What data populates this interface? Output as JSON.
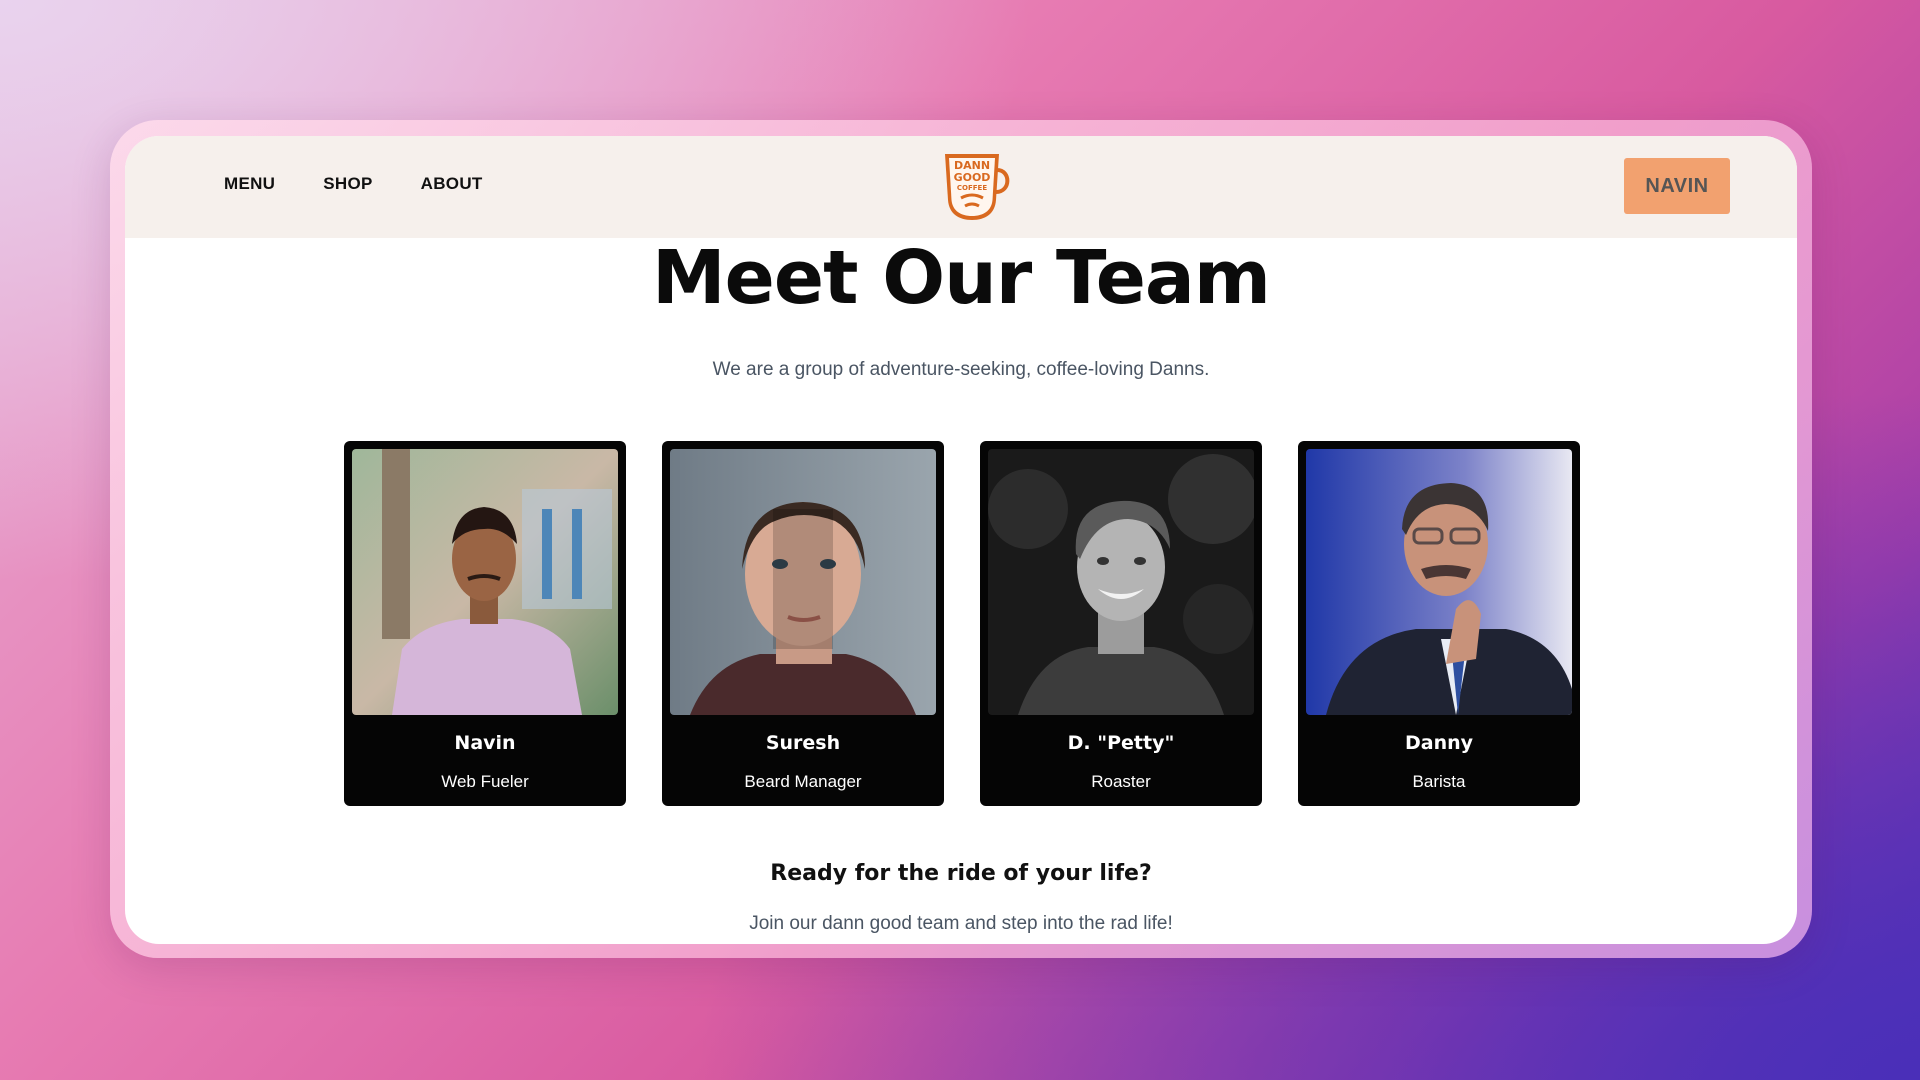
{
  "nav": {
    "links": [
      {
        "label": "MENU"
      },
      {
        "label": "SHOP"
      },
      {
        "label": "ABOUT"
      }
    ],
    "logo_icon": "dann-good-coffee-mug-logo",
    "logo_text": [
      "DANN",
      "GOOD",
      "COFFEE"
    ],
    "user_button": "NAVIN",
    "accent_color": "#f2a16f"
  },
  "hero": {
    "title": "Meet Our Team",
    "subtitle": "We are a group of adventure-seeking, coffee-loving Danns."
  },
  "team": [
    {
      "name": "Navin",
      "role": "Web Fueler"
    },
    {
      "name": "Suresh",
      "role": "Beard Manager"
    },
    {
      "name": "D. \"Petty\"",
      "role": "Roaster"
    },
    {
      "name": "Danny",
      "role": "Barista"
    }
  ],
  "footer_cta": {
    "heading": "Ready for the ride of your life?",
    "text": "Join our dann good team and step into the rad life!"
  }
}
